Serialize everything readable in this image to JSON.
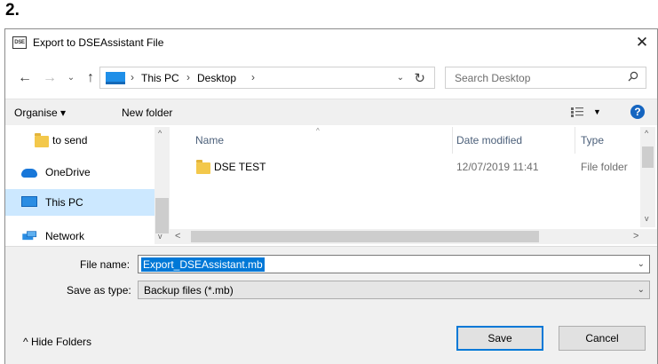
{
  "step_label": "2.",
  "window": {
    "app_icon_text": "DSE",
    "title": "Export to DSEAssistant File",
    "close_glyph": "✕"
  },
  "navigation": {
    "back_glyph": "←",
    "forward_glyph": "→",
    "recent_glyph": "⌄",
    "up_glyph": "↑",
    "address": {
      "breadcrumbs": [
        "This PC",
        "Desktop"
      ],
      "separator": "›",
      "dropdown_glyph": "⌄",
      "refresh_glyph": "↻"
    },
    "search": {
      "placeholder": "Search Desktop"
    }
  },
  "toolbar": {
    "organise_label": "Organise ▾",
    "new_folder_label": "New folder",
    "view_dropdown_glyph": "▼",
    "help_glyph": "?"
  },
  "nav_pane": {
    "items": [
      {
        "label": "to send",
        "icon": "folder-icon",
        "selected": false
      },
      {
        "label": "OneDrive",
        "icon": "onedrive-icon",
        "selected": false
      },
      {
        "label": "This PC",
        "icon": "this-pc-icon",
        "selected": true
      },
      {
        "label": "Network",
        "icon": "network-icon",
        "selected": false
      }
    ],
    "scroll_up_glyph": "^",
    "scroll_down_glyph": "v"
  },
  "file_list": {
    "columns": [
      "Name",
      "Date modified",
      "Type"
    ],
    "sort_caret": "^",
    "rows": [
      {
        "name": "DSE TEST",
        "date_modified": "12/07/2019 11:41",
        "type": "File folder"
      }
    ],
    "scroll_left_glyph": "<",
    "scroll_right_glyph": ">"
  },
  "form": {
    "file_name_label": "File name:",
    "file_name_value": "Export_DSEAssistant.mb",
    "save_type_label": "Save as type:",
    "save_type_value": "Backup files (*.mb)",
    "dropdown_glyph": "⌄"
  },
  "footer": {
    "hide_folders_label": "^  Hide Folders",
    "save_label": "Save",
    "cancel_label": "Cancel"
  },
  "colors": {
    "selection": "#0078d7",
    "nav_selected": "#cce8ff",
    "folder": "#f3c84b",
    "help": "#1565c0"
  }
}
